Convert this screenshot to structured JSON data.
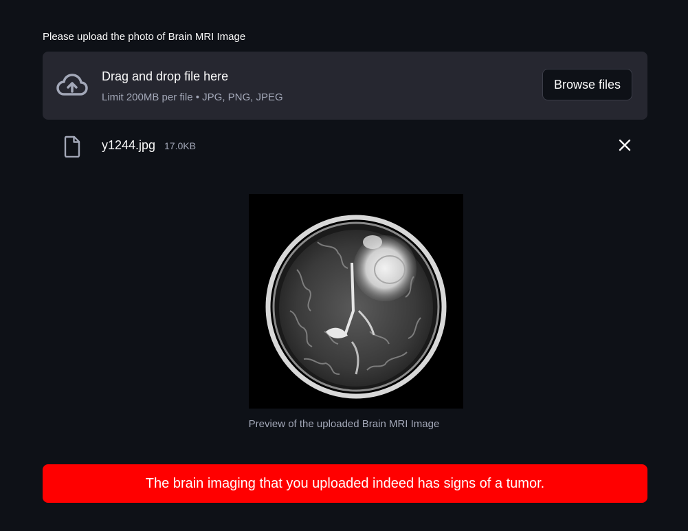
{
  "uploader": {
    "label": "Please upload the photo of Brain MRI Image",
    "dropzone_title": "Drag and drop file here",
    "dropzone_limit": "Limit 200MB per file • JPG, PNG, JPEG",
    "browse_label": "Browse files",
    "upload_icon": "cloud-upload-icon"
  },
  "uploaded_file": {
    "name": "y1244.jpg",
    "size": "17.0KB",
    "file_icon": "file-icon",
    "remove_icon": "close-icon"
  },
  "preview": {
    "caption": "Preview of the uploaded Brain MRI Image"
  },
  "result": {
    "message": "The brain imaging that you uploaded indeed has signs of a tumor.",
    "color": "#ff0000"
  },
  "theme": {
    "background": "#0e1117",
    "panel": "#262730",
    "text": "#fafafa",
    "muted_text": "#a3a8b8"
  }
}
